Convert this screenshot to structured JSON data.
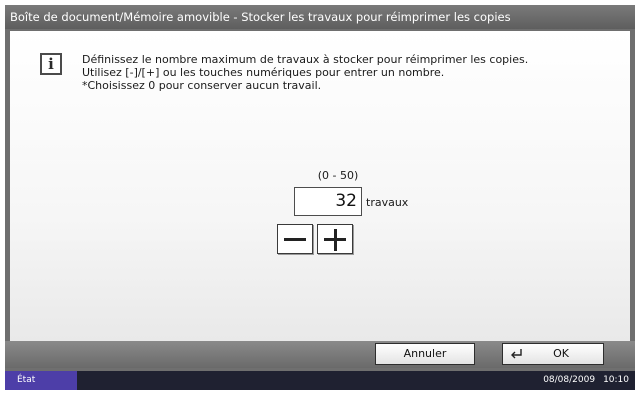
{
  "header": {
    "title": "Boîte de document/Mémoire amovible - Stocker les travaux pour réimprimer les copies"
  },
  "message": {
    "icon": "info-icon",
    "lines": [
      "Définissez le nombre maximum de travaux à stocker pour réimprimer les copies.",
      "Utilisez [-]/[+] ou les touches numériques pour entrer un nombre.",
      "*Choisissez 0 pour conserver aucun travail."
    ]
  },
  "setting": {
    "range": "(0 - 50)",
    "value": "32",
    "unit": "travaux",
    "minus_icon": "minus-icon",
    "plus_icon": "plus-icon"
  },
  "footer": {
    "cancel_label": "Annuler",
    "ok_label": "OK",
    "ok_icon": "enter-icon"
  },
  "status": {
    "label": "État",
    "date": "08/08/2009",
    "time": "10:10"
  }
}
